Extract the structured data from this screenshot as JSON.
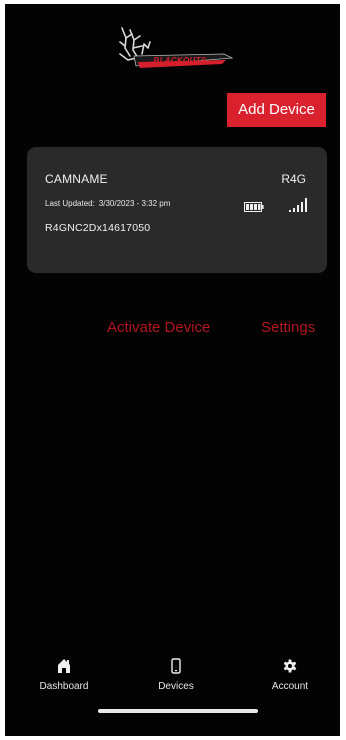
{
  "app": {
    "logo_text": "BLACKOUTS",
    "logo_icon": "antlers-logo-icon"
  },
  "header": {
    "add_device_label": "Add Device"
  },
  "device_card": {
    "name": "CAMNAME",
    "model": "R4G",
    "last_updated_label": "Last Updated:",
    "last_updated_value": "3/30/2023 - 3:32 pm",
    "serial": "R4GNC2Dx14617050",
    "battery_icon": "battery-icon",
    "signal_icon": "signal-bars-icon"
  },
  "actions": {
    "activate_label": "Activate Device",
    "settings_label": "Settings"
  },
  "tabbar": {
    "items": [
      {
        "label": "Dashboard",
        "icon": "home-icon"
      },
      {
        "label": "Devices",
        "icon": "phone-icon"
      },
      {
        "label": "Account",
        "icon": "gear-icon"
      }
    ]
  },
  "colors": {
    "accent": "#d9222e",
    "link": "#b3151f",
    "background": "#030303",
    "card": "#2a2a2a"
  }
}
